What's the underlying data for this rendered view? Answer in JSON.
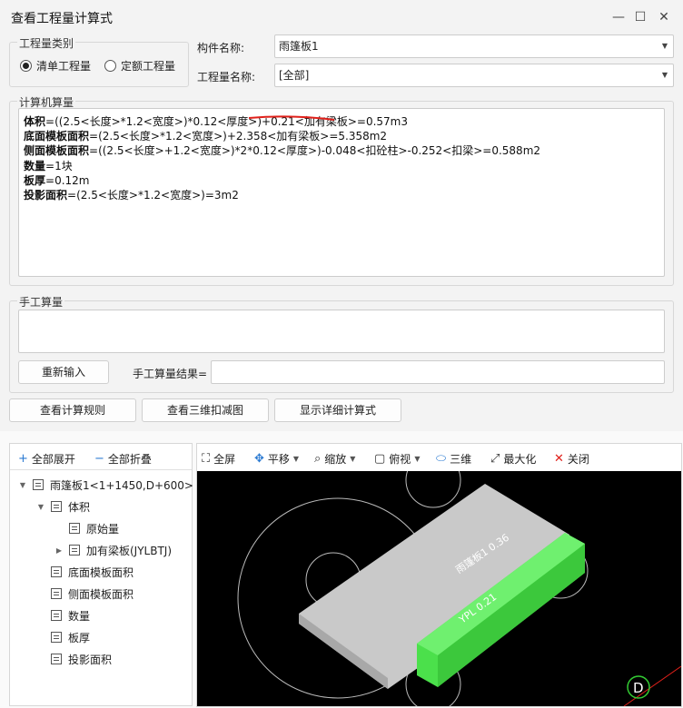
{
  "window": {
    "title": "查看工程量计算式",
    "minimize_glyph": "—",
    "maximize_glyph": "☐",
    "close_glyph": "✕"
  },
  "qty_type": {
    "legend": "工程量类别",
    "options": [
      {
        "label": "清单工程量",
        "selected": true
      },
      {
        "label": "定额工程量",
        "selected": false
      }
    ]
  },
  "component": {
    "label": "构件名称:",
    "value": "雨篷板1"
  },
  "qty_name": {
    "label": "工程量名称:",
    "value": "[全部]"
  },
  "computer_calc": {
    "legend": "计算机算量",
    "lines": [
      {
        "name": "体积",
        "expr": "=((2.5<长度>*1.2<宽度>)*0.12<厚度>)+0.21<加有梁板>=0.57m3"
      },
      {
        "name": "底面模板面积",
        "expr": "=(2.5<长度>*1.2<宽度>)+2.358<加有梁板>=5.358m2"
      },
      {
        "name": "侧面模板面积",
        "expr": "=((2.5<长度>+1.2<宽度>)*2*0.12<厚度>)-0.048<扣砼柱>-0.252<扣梁>=0.588m2"
      },
      {
        "name": "数量",
        "expr": "=1块"
      },
      {
        "name": "板厚",
        "expr": "=0.12m"
      },
      {
        "name": "投影面积",
        "expr": "=(2.5<长度>*1.2<宽度>)=3m2"
      }
    ]
  },
  "manual_calc": {
    "legend": "手工算量",
    "reenter_label": "重新输入",
    "result_label": "手工算量结果=",
    "result_value": ""
  },
  "action_buttons": {
    "rules": "查看计算规则",
    "view3d": "查看三维扣减图",
    "detail": "显示详细计算式"
  },
  "tree_toolbar": {
    "expand_all": "全部展开",
    "collapse_all": "全部折叠"
  },
  "viewer_toolbar": {
    "fullscreen": "全屏",
    "pan": "平移",
    "zoom": "缩放",
    "top_view": "俯视",
    "three_d": "三维",
    "maximize": "最大化",
    "close": "关闭"
  },
  "tree": {
    "root": "雨篷板1<1+1450,D+600>",
    "items": [
      {
        "label": "体积",
        "level": 1,
        "toggle": "▼"
      },
      {
        "label": "原始量",
        "level": 2,
        "toggle": ""
      },
      {
        "label": "加有梁板(JYLBTJ)",
        "level": 2,
        "toggle": "▶"
      },
      {
        "label": "底面模板面积",
        "level": 1,
        "toggle": ""
      },
      {
        "label": "侧面模板面积",
        "level": 1,
        "toggle": ""
      },
      {
        "label": "数量",
        "level": 1,
        "toggle": ""
      },
      {
        "label": "板厚",
        "level": 1,
        "toggle": ""
      },
      {
        "label": "投影面积",
        "level": 1,
        "toggle": ""
      }
    ]
  },
  "viewport": {
    "slab_label": "雨篷板1 0.36",
    "beam_label": "YPL 0.21",
    "axis_marker": "D",
    "slab_color": "#c9c9c9",
    "beam_color": "#4be04b"
  },
  "colors": {
    "annotation_red": "#e0201a",
    "accent_blue": "#2a7ad2"
  }
}
